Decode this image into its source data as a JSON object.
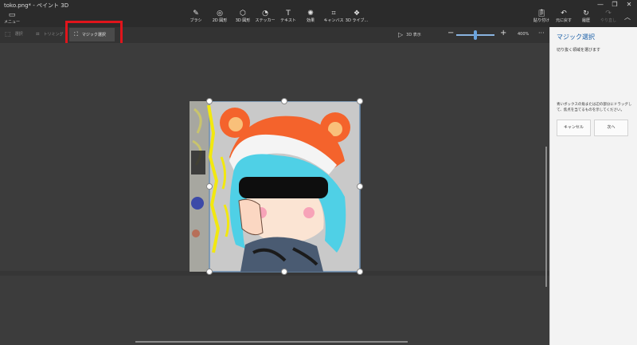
{
  "window": {
    "title": "toko.png* - ペイント 3D",
    "controls": {
      "minimize": "—",
      "maximize": "❐",
      "close": "✕"
    }
  },
  "ribbon": {
    "menu_label": "メニュー",
    "tools": [
      {
        "label": "ブラシ",
        "icon": "brush-icon"
      },
      {
        "label": "2D 図形",
        "icon": "2d-shapes-icon"
      },
      {
        "label": "3D 図形",
        "icon": "3d-shapes-icon"
      },
      {
        "label": "ステッカー",
        "icon": "stickers-icon"
      },
      {
        "label": "テキスト",
        "icon": "text-icon"
      },
      {
        "label": "効果",
        "icon": "effects-icon"
      },
      {
        "label": "キャンバス",
        "icon": "canvas-icon"
      },
      {
        "label": "3D ライブ...",
        "icon": "3d-library-icon"
      }
    ],
    "right_tools": [
      {
        "label": "貼り付け",
        "icon": "paste-icon"
      },
      {
        "label": "元に戻す",
        "icon": "undo-icon"
      },
      {
        "label": "履歴",
        "icon": "history-icon"
      },
      {
        "label": "やり直し",
        "icon": "redo-icon"
      }
    ]
  },
  "toolbar": {
    "select_label": "選択",
    "crop_label": "トリミング",
    "magic_select_label": "マジック選択",
    "view_3d_label": "3D 表示",
    "zoom_level": "400%",
    "zoom_fraction": 0.5,
    "more": "···"
  },
  "panel": {
    "title": "マジック選択",
    "description": "切り抜く領域を選びます",
    "help": "青いボックスの角または辺の部分にドラッグして、焦点を当てるものを示してください。",
    "cancel_label": "キャンセル",
    "next_label": "次へ"
  },
  "colors": {
    "accent": "#1a5fa8",
    "highlight_box": "#e0141b",
    "zoom_slider": "#6aa3dd"
  }
}
